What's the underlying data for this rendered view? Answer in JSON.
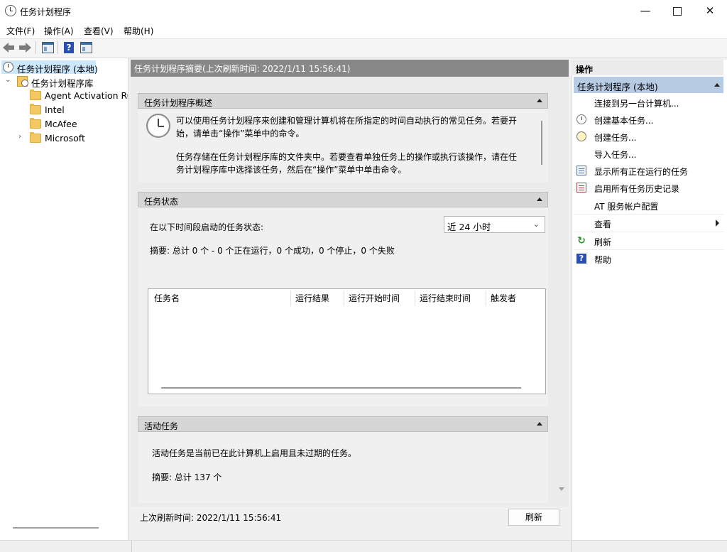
{
  "window": {
    "title": "任务计划程序",
    "min": "—",
    "close": "✕"
  },
  "menu": [
    "文件(F)",
    "操作(A)",
    "查看(V)",
    "帮助(H)"
  ],
  "tree": {
    "root": "任务计划程序 (本地)",
    "library": "任务计划程序库",
    "folders": [
      "Agent Activation Runtime",
      "Intel",
      "McAfee",
      "Microsoft"
    ]
  },
  "center": {
    "header": "任务计划程序摘要(上次刷新时间: 2022/1/11 15:56:41)",
    "overview": {
      "title": "任务计划程序概述",
      "p1_line1": "可以使用任务计划程序来创建和管理计算机将在所指定的时间自动执行的常见任务。若要开",
      "p1_line2": "始，请单击“操作”菜单中的命令。",
      "p2_line1": "任务存储在任务计划程序库的文件夹中。若要查看单独任务上的操作或执行该操作，请在任",
      "p2_line2": "务计划程序库中选择该任务，然后在“操作”菜单中单击命令。"
    },
    "status": {
      "title": "任务状态",
      "label": "在以下时间段启动的任务状态:",
      "range": "近 24 小时",
      "summary": "摘要: 总计 0 个 - 0 个正在运行，0 个成功，0 个停止，0 个失败",
      "columns": [
        "任务名",
        "运行结果",
        "运行开始时间",
        "运行结束时间",
        "触发者"
      ]
    },
    "active": {
      "title": "活动任务",
      "desc": "活动任务是当前已在此计算机上启用且未过期的任务。",
      "summary": "摘要: 总计 137 个"
    },
    "footer": {
      "last_refresh": "上次刷新时间: 2022/1/11 15:56:41",
      "refresh_button": "刷新"
    }
  },
  "actions": {
    "title": "操作",
    "group": "任务计划程序 (本地)",
    "items": [
      "连接到另一台计算机...",
      "创建基本任务...",
      "创建任务...",
      "导入任务...",
      "显示所有正在运行的任务",
      "启用所有任务历史记录",
      "AT 服务帐户配置",
      "查看",
      "刷新",
      "帮助"
    ]
  }
}
